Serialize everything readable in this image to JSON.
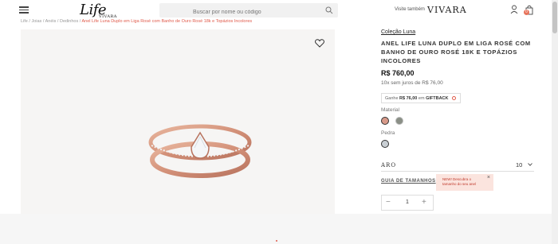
{
  "header": {
    "logo_text": "Life",
    "logo_sub": "VIVARA",
    "search_placeholder": "Buscar por nome ou código",
    "visite_text": "Visite também",
    "vivara_brand": "VIVARA",
    "cart_count": "0"
  },
  "breadcrumb": {
    "items": [
      "Life",
      "Joias",
      "Anéis",
      "Dedinhos"
    ],
    "current": "Anel Life Luna Duplo em Liga Rosé com Banho de Ouro Rosé 18k e Topázios Incolores"
  },
  "product": {
    "collection": "Coleção Luna",
    "title": "ANEL LIFE LUNA DUPLO EM LIGA ROSÉ COM BANHO DE OURO ROSÉ 18K E TOPÁZIOS INCOLORES",
    "price": "R$ 760,00",
    "installments": "10x sem juros de R$ 76,00",
    "giftback_prefix": "Ganhe",
    "giftback_amount": "R$ 76,00",
    "giftback_mid": "em",
    "giftback_label": "GIFTBACK",
    "material_label": "Material",
    "pedra_label": "Pedra",
    "material_swatches": [
      "#d89a8a",
      "#8a8f86"
    ],
    "pedra_swatches": [
      "#c9cfd4"
    ],
    "aro_label": "ARO",
    "aro_value": "10",
    "size_guide": "GUIA DE TAMANHOS",
    "tooltip_line1": "NEW! Descubra o",
    "tooltip_line2": "tamanho do seu anel",
    "quantity": "1"
  }
}
